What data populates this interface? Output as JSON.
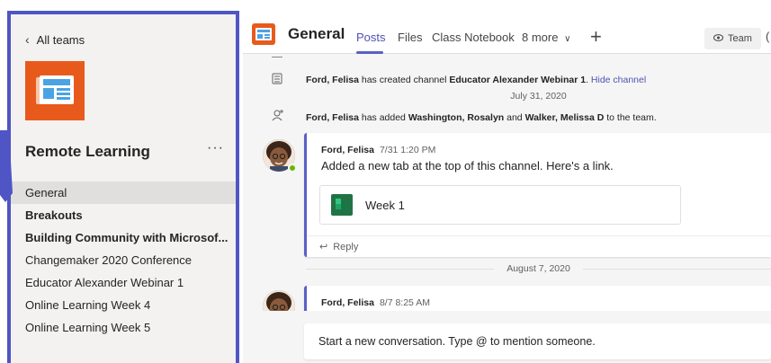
{
  "sidebar": {
    "back_label": "All teams",
    "team_name": "Remote Learning",
    "more_label": "···",
    "channels": [
      {
        "label": "General"
      },
      {
        "label": "Breakouts"
      },
      {
        "label": "Building Community with Microsof..."
      },
      {
        "label": "Changemaker 2020 Conference"
      },
      {
        "label": "Educator Alexander Webinar 1"
      },
      {
        "label": "Online Learning Week 4"
      },
      {
        "label": "Online Learning Week 5"
      }
    ]
  },
  "header": {
    "title": "General",
    "tabs": [
      "Posts",
      "Files",
      "Class Notebook",
      "8 more"
    ],
    "team_button": "Team"
  },
  "feed": {
    "sys1": {
      "actor": "Ford, Felisa",
      "text1": " has created channel ",
      "channel": "Educator Alexander Webinar 1",
      "text2": ". ",
      "link": "Hide channel"
    },
    "date1": "July 31, 2020",
    "sys2": {
      "actor": "Ford, Felisa",
      "text1": " has added ",
      "user1": "Washington, Rosalyn",
      "text2": " and ",
      "user2": "Walker, Melissa D",
      "text3": " to the team."
    },
    "post1": {
      "author": "Ford, Felisa",
      "time": "7/31 1:20 PM",
      "body": "Added a new tab at the top of this channel. Here's a link.",
      "tab_card": "Week 1",
      "reply": "Reply"
    },
    "date2": "August 7, 2020",
    "post2": {
      "author": "Ford, Felisa",
      "time": "8/7 8:25 AM"
    }
  },
  "compose": {
    "placeholder": "Start a new conversation. Type @ to mention someone."
  },
  "colors": {
    "accent": "#5b5fc7",
    "highlight_border": "#4f55c4",
    "team_logo": "#e85a1c",
    "presence": "#6bb700"
  }
}
